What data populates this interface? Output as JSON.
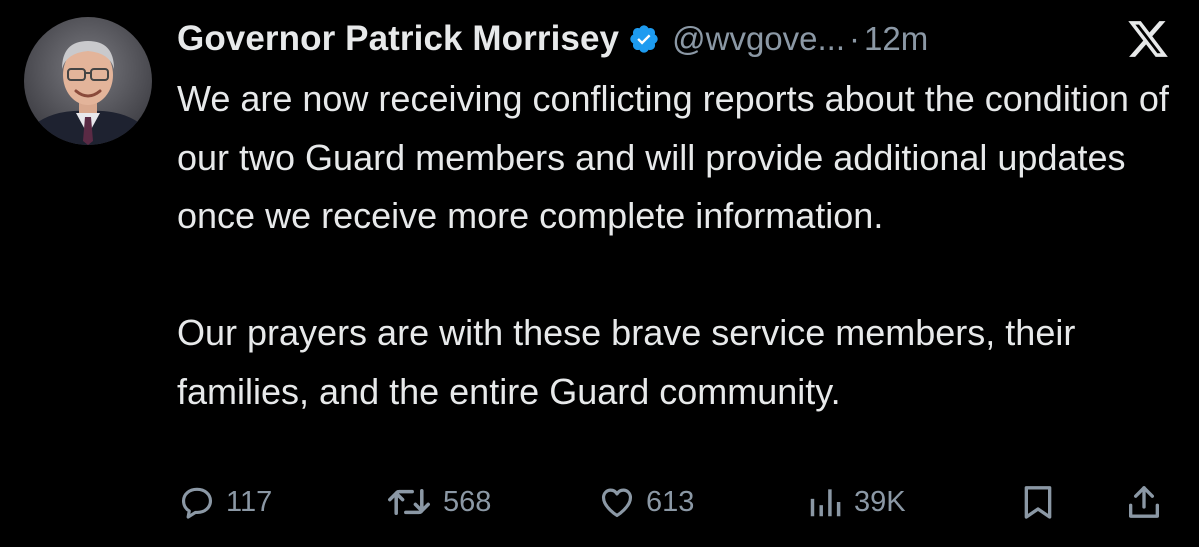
{
  "tweet": {
    "author_name": "Governor Patrick Morrisey",
    "handle": "@wvgove...",
    "separator": "·",
    "time": "12m",
    "text_paragraphs": [
      "We are now receiving conflicting reports about the condition of our two Guard members and will provide additional updates once we receive more complete information.",
      "Our prayers are with these brave service members, their families, and the entire Guard community."
    ],
    "verified": true,
    "verified_color": "#1d9bf0"
  },
  "actions": {
    "replies": "117",
    "reposts": "568",
    "likes": "613",
    "views": "39K"
  },
  "icons": {
    "avatar": "profile-photo",
    "verified": "verified-badge-icon",
    "platform": "x-logo-icon",
    "reply": "reply-icon",
    "repost": "repost-icon",
    "like": "heart-icon",
    "views": "views-chart-icon",
    "bookmark": "bookmark-icon",
    "share": "share-icon"
  },
  "colors": {
    "background": "#000000",
    "text": "#e7e9ea",
    "secondary": "#8b98a5"
  }
}
